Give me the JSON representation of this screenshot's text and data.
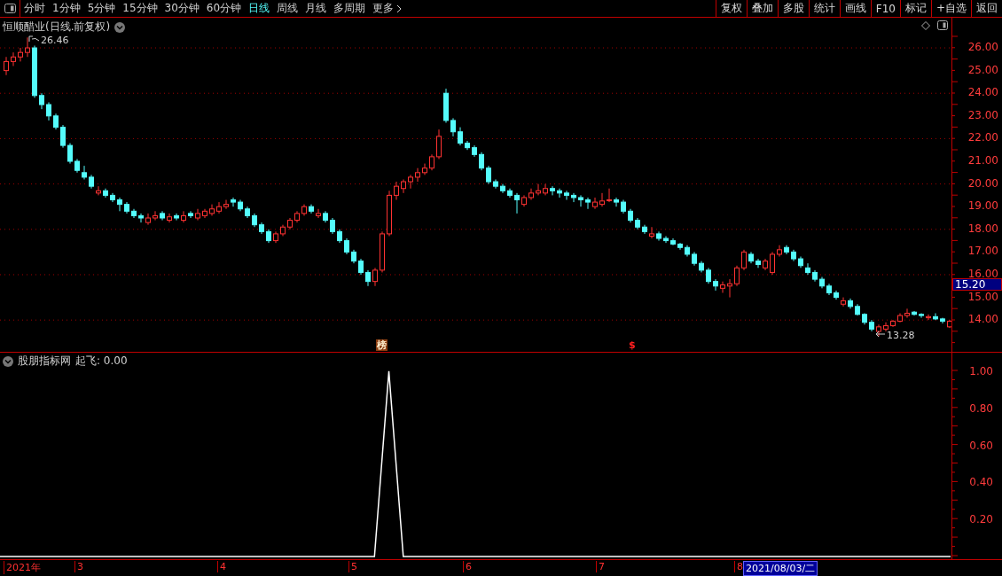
{
  "toolbar": {
    "periods": [
      {
        "label": "分时",
        "selected": false
      },
      {
        "label": "1分钟",
        "selected": false
      },
      {
        "label": "5分钟",
        "selected": false
      },
      {
        "label": "15分钟",
        "selected": false
      },
      {
        "label": "30分钟",
        "selected": false
      },
      {
        "label": "60分钟",
        "selected": false
      },
      {
        "label": "日线",
        "selected": true
      },
      {
        "label": "周线",
        "selected": false
      },
      {
        "label": "月线",
        "selected": false
      },
      {
        "label": "多周期",
        "selected": false
      },
      {
        "label": "更多",
        "selected": false
      }
    ],
    "actions": [
      "复权",
      "叠加",
      "多股",
      "统计",
      "画线",
      "F10",
      "标记",
      "+自选",
      "返回"
    ]
  },
  "price_panel": {
    "title": "恒顺醋业(日线.前复权)",
    "high_label": "26.46",
    "low_label": "13.28",
    "current_price": "15.20",
    "markers": [
      {
        "kind": "rank",
        "label": "榜"
      },
      {
        "kind": "dollar",
        "label": "$"
      }
    ],
    "chart_data": {
      "type": "candlestick",
      "ylim": [
        12.6,
        27.33
      ],
      "grid": true,
      "yticks": [
        {
          "value": 26,
          "label": "26.00"
        },
        {
          "value": 25,
          "label": "25.00"
        },
        {
          "value": 24,
          "label": "24.00"
        },
        {
          "value": 23,
          "label": "23.00"
        },
        {
          "value": 22,
          "label": "22.00"
        },
        {
          "value": 21,
          "label": "21.00"
        },
        {
          "value": 20,
          "label": "20.00"
        },
        {
          "value": 19,
          "label": "19.00"
        },
        {
          "value": 18,
          "label": "18.00"
        },
        {
          "value": 17,
          "label": "17.00"
        },
        {
          "value": 16,
          "label": "16.00"
        },
        {
          "value": 15,
          "label": "15.00"
        },
        {
          "value": 14,
          "label": "14.00"
        }
      ],
      "ohlc": [
        [
          25.0,
          25.6,
          24.8,
          25.4
        ],
        [
          25.4,
          25.8,
          25.2,
          25.6
        ],
        [
          25.6,
          26.0,
          25.4,
          25.8
        ],
        [
          25.8,
          26.46,
          25.6,
          26.0
        ],
        [
          26.0,
          26.1,
          23.8,
          23.9
        ],
        [
          23.9,
          24.0,
          23.3,
          23.5
        ],
        [
          23.5,
          23.6,
          22.8,
          23.0
        ],
        [
          23.0,
          23.1,
          22.4,
          22.5
        ],
        [
          22.5,
          22.6,
          21.6,
          21.7
        ],
        [
          21.7,
          21.8,
          20.9,
          21.0
        ],
        [
          21.0,
          21.1,
          20.5,
          20.6
        ],
        [
          20.5,
          20.8,
          20.2,
          20.3
        ],
        [
          20.3,
          20.4,
          19.8,
          19.9
        ],
        [
          19.6,
          19.9,
          19.5,
          19.7
        ],
        [
          19.7,
          19.8,
          19.4,
          19.5
        ],
        [
          19.5,
          19.6,
          19.2,
          19.3
        ],
        [
          19.3,
          19.4,
          18.8,
          19.1
        ],
        [
          19.1,
          19.2,
          18.7,
          18.8
        ],
        [
          18.8,
          18.9,
          18.5,
          18.6
        ],
        [
          18.6,
          18.7,
          18.3,
          18.5
        ],
        [
          18.3,
          18.7,
          18.2,
          18.5
        ],
        [
          18.5,
          18.8,
          18.4,
          18.6
        ],
        [
          18.7,
          18.8,
          18.4,
          18.5
        ],
        [
          18.4,
          18.7,
          18.3,
          18.55
        ],
        [
          18.6,
          18.7,
          18.4,
          18.5
        ],
        [
          18.4,
          18.8,
          18.3,
          18.6
        ],
        [
          18.7,
          18.8,
          18.5,
          18.6
        ],
        [
          18.5,
          18.9,
          18.4,
          18.7
        ],
        [
          18.6,
          18.9,
          18.5,
          18.8
        ],
        [
          18.7,
          19.1,
          18.6,
          18.9
        ],
        [
          18.8,
          19.2,
          18.7,
          19.0
        ],
        [
          19.0,
          19.3,
          18.9,
          19.1
        ],
        [
          19.3,
          19.4,
          19.0,
          19.2
        ],
        [
          19.2,
          19.3,
          18.8,
          18.9
        ],
        [
          18.9,
          19.0,
          18.5,
          18.6
        ],
        [
          18.6,
          18.7,
          18.1,
          18.2
        ],
        [
          18.2,
          18.3,
          17.8,
          17.9
        ],
        [
          17.9,
          18.0,
          17.4,
          17.5
        ],
        [
          17.5,
          17.9,
          17.4,
          17.8
        ],
        [
          17.8,
          18.2,
          17.7,
          18.1
        ],
        [
          18.1,
          18.5,
          18.0,
          18.4
        ],
        [
          18.4,
          18.8,
          18.3,
          18.7
        ],
        [
          18.7,
          19.1,
          18.6,
          19.0
        ],
        [
          19.0,
          19.1,
          18.7,
          18.8
        ],
        [
          18.6,
          18.9,
          18.5,
          18.7
        ],
        [
          18.7,
          18.8,
          18.3,
          18.4
        ],
        [
          18.4,
          18.5,
          17.8,
          17.9
        ],
        [
          17.9,
          18.0,
          17.4,
          17.5
        ],
        [
          17.5,
          17.6,
          16.9,
          17.0
        ],
        [
          17.0,
          17.1,
          16.5,
          16.6
        ],
        [
          16.6,
          16.7,
          16.0,
          16.1
        ],
        [
          16.1,
          16.2,
          15.5,
          15.7
        ],
        [
          15.7,
          16.3,
          15.5,
          16.2
        ],
        [
          16.2,
          17.9,
          16.1,
          17.8
        ],
        [
          17.8,
          19.7,
          17.7,
          19.5
        ],
        [
          19.5,
          20.1,
          19.3,
          19.9
        ],
        [
          19.8,
          20.2,
          19.6,
          20.1
        ],
        [
          20.1,
          20.4,
          19.8,
          20.3
        ],
        [
          20.3,
          20.7,
          20.1,
          20.5
        ],
        [
          20.5,
          20.9,
          20.4,
          20.7
        ],
        [
          20.7,
          21.3,
          20.6,
          21.2
        ],
        [
          21.2,
          22.4,
          21.1,
          22.1
        ],
        [
          24.0,
          24.2,
          22.7,
          22.8
        ],
        [
          22.8,
          22.9,
          22.1,
          22.3
        ],
        [
          22.3,
          22.5,
          21.7,
          21.8
        ],
        [
          21.8,
          21.9,
          21.5,
          21.6
        ],
        [
          21.6,
          21.7,
          21.2,
          21.3
        ],
        [
          21.3,
          21.4,
          20.6,
          20.7
        ],
        [
          20.7,
          20.8,
          20.0,
          20.1
        ],
        [
          20.1,
          20.2,
          19.8,
          19.9
        ],
        [
          19.9,
          20.0,
          19.6,
          19.7
        ],
        [
          19.7,
          19.8,
          19.4,
          19.5
        ],
        [
          19.5,
          19.6,
          18.7,
          19.3
        ],
        [
          19.1,
          19.5,
          19.0,
          19.4
        ],
        [
          19.4,
          19.8,
          19.3,
          19.6
        ],
        [
          19.6,
          20.0,
          19.5,
          19.7
        ],
        [
          19.6,
          20.0,
          19.5,
          19.8
        ],
        [
          19.8,
          19.9,
          19.5,
          19.7
        ],
        [
          19.7,
          19.8,
          19.4,
          19.6
        ],
        [
          19.6,
          19.7,
          19.3,
          19.5
        ],
        [
          19.5,
          19.6,
          19.2,
          19.4
        ],
        [
          19.4,
          19.5,
          19.0,
          19.3
        ],
        [
          19.3,
          19.4,
          18.9,
          19.2
        ],
        [
          19.0,
          19.4,
          18.9,
          19.2
        ],
        [
          19.1,
          19.6,
          19.0,
          19.25
        ],
        [
          19.3,
          19.8,
          19.2,
          19.3
        ],
        [
          19.3,
          19.4,
          19.0,
          19.2
        ],
        [
          19.2,
          19.3,
          18.7,
          18.8
        ],
        [
          18.8,
          18.9,
          18.3,
          18.4
        ],
        [
          18.4,
          18.5,
          18.0,
          18.1
        ],
        [
          18.1,
          18.2,
          17.8,
          17.9
        ],
        [
          17.7,
          18.1,
          17.6,
          17.8
        ],
        [
          17.8,
          17.9,
          17.5,
          17.6
        ],
        [
          17.6,
          17.7,
          17.4,
          17.5
        ],
        [
          17.5,
          17.6,
          17.3,
          17.35
        ],
        [
          17.35,
          17.4,
          17.1,
          17.2
        ],
        [
          17.2,
          17.3,
          16.8,
          16.9
        ],
        [
          16.9,
          17.0,
          16.4,
          16.5
        ],
        [
          16.5,
          16.6,
          16.1,
          16.2
        ],
        [
          16.2,
          16.3,
          15.6,
          15.7
        ],
        [
          15.7,
          15.8,
          15.3,
          15.5
        ],
        [
          15.4,
          15.7,
          15.2,
          15.55
        ],
        [
          15.5,
          15.8,
          15.0,
          15.6
        ],
        [
          15.6,
          16.4,
          15.5,
          16.3
        ],
        [
          16.3,
          17.1,
          16.2,
          17.0
        ],
        [
          16.9,
          17.0,
          16.5,
          16.6
        ],
        [
          16.6,
          16.7,
          16.3,
          16.45
        ],
        [
          16.3,
          16.7,
          16.2,
          16.6
        ],
        [
          16.1,
          17.0,
          16.0,
          16.9
        ],
        [
          16.9,
          17.3,
          16.8,
          17.1
        ],
        [
          17.2,
          17.3,
          16.9,
          17.0
        ],
        [
          17.0,
          17.1,
          16.6,
          16.7
        ],
        [
          16.7,
          16.8,
          16.3,
          16.4
        ],
        [
          16.3,
          16.5,
          16.0,
          16.1
        ],
        [
          16.1,
          16.2,
          15.7,
          15.8
        ],
        [
          15.8,
          15.9,
          15.4,
          15.5
        ],
        [
          15.5,
          15.6,
          15.1,
          15.2
        ],
        [
          15.2,
          15.3,
          14.9,
          15.0
        ],
        [
          14.7,
          15.0,
          14.6,
          14.85
        ],
        [
          14.85,
          14.95,
          14.5,
          14.6
        ],
        [
          14.6,
          14.7,
          14.2,
          14.25
        ],
        [
          14.25,
          14.3,
          13.8,
          13.9
        ],
        [
          13.9,
          14.0,
          13.5,
          13.6
        ],
        [
          13.5,
          13.8,
          13.28,
          13.7
        ],
        [
          13.6,
          13.9,
          13.5,
          13.75
        ],
        [
          13.75,
          14.0,
          13.7,
          13.95
        ],
        [
          13.95,
          14.3,
          13.9,
          14.2
        ],
        [
          14.2,
          14.5,
          14.1,
          14.3
        ],
        [
          14.35,
          14.4,
          14.2,
          14.25
        ],
        [
          14.25,
          14.3,
          14.1,
          14.2
        ],
        [
          14.1,
          14.25,
          14.0,
          14.15
        ],
        [
          14.15,
          14.3,
          14.0,
          14.05
        ],
        [
          14.05,
          14.1,
          13.85,
          13.95
        ],
        [
          13.7,
          14.0,
          13.65,
          13.95
        ]
      ]
    }
  },
  "indicator_panel": {
    "name": "股朋指标网",
    "reading": ": 0.00",
    "chart_data": {
      "type": "line",
      "ylim": [
        -0.01,
        1.1
      ],
      "yticks": [
        {
          "value": 1,
          "label": "1.00"
        },
        {
          "value": 0.8,
          "label": "0.80"
        },
        {
          "value": 0.6,
          "label": "0.60"
        },
        {
          "value": 0.4,
          "label": "0.40"
        },
        {
          "value": 0.2,
          "label": "0.20"
        }
      ],
      "series": [
        {
          "name": "起飞",
          "color": "#ffffff",
          "values": [
            0,
            0,
            0,
            0,
            0,
            0,
            0,
            0,
            0,
            0,
            0,
            0,
            0,
            0,
            0,
            0,
            0,
            0,
            0,
            0,
            0,
            0,
            0,
            0,
            0,
            0,
            0,
            1,
            0,
            0,
            0,
            0,
            0,
            0,
            0,
            0,
            0,
            0,
            0,
            0,
            0,
            0,
            0,
            0,
            0,
            0,
            0,
            0,
            0,
            0,
            0,
            0,
            0,
            0,
            0,
            0,
            0,
            0,
            0,
            0,
            0,
            0,
            0,
            0,
            0,
            0,
            0
          ]
        }
      ]
    }
  },
  "time_axis": {
    "labels": [
      "2021年",
      "3",
      "4",
      "5",
      "6",
      "7",
      "8"
    ],
    "cursor_date": "2021/08/03/二"
  }
}
